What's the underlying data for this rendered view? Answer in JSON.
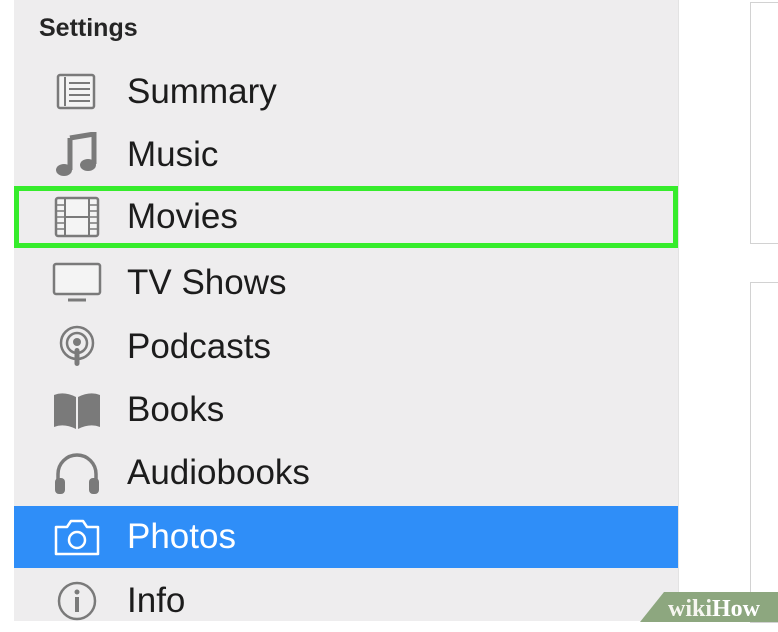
{
  "sidebar": {
    "section_title": "Settings",
    "items": [
      {
        "label": "Summary",
        "icon": "summary-icon"
      },
      {
        "label": "Music",
        "icon": "music-note-icon"
      },
      {
        "label": "Movies",
        "icon": "film-icon",
        "highlighted": true
      },
      {
        "label": "TV Shows",
        "icon": "tv-icon"
      },
      {
        "label": "Podcasts",
        "icon": "podcast-icon"
      },
      {
        "label": "Books",
        "icon": "book-icon"
      },
      {
        "label": "Audiobooks",
        "icon": "headphones-icon"
      },
      {
        "label": "Photos",
        "icon": "camera-icon",
        "selected": true
      },
      {
        "label": "Info",
        "icon": "info-icon"
      }
    ]
  },
  "watermark": {
    "part1": "wiki",
    "part2": "How"
  },
  "colors": {
    "selection": "#2f8ef8",
    "highlight_outline": "#36ec2c",
    "sidebar_bg": "#eeedee",
    "icon_gray": "#7a7a7a"
  }
}
